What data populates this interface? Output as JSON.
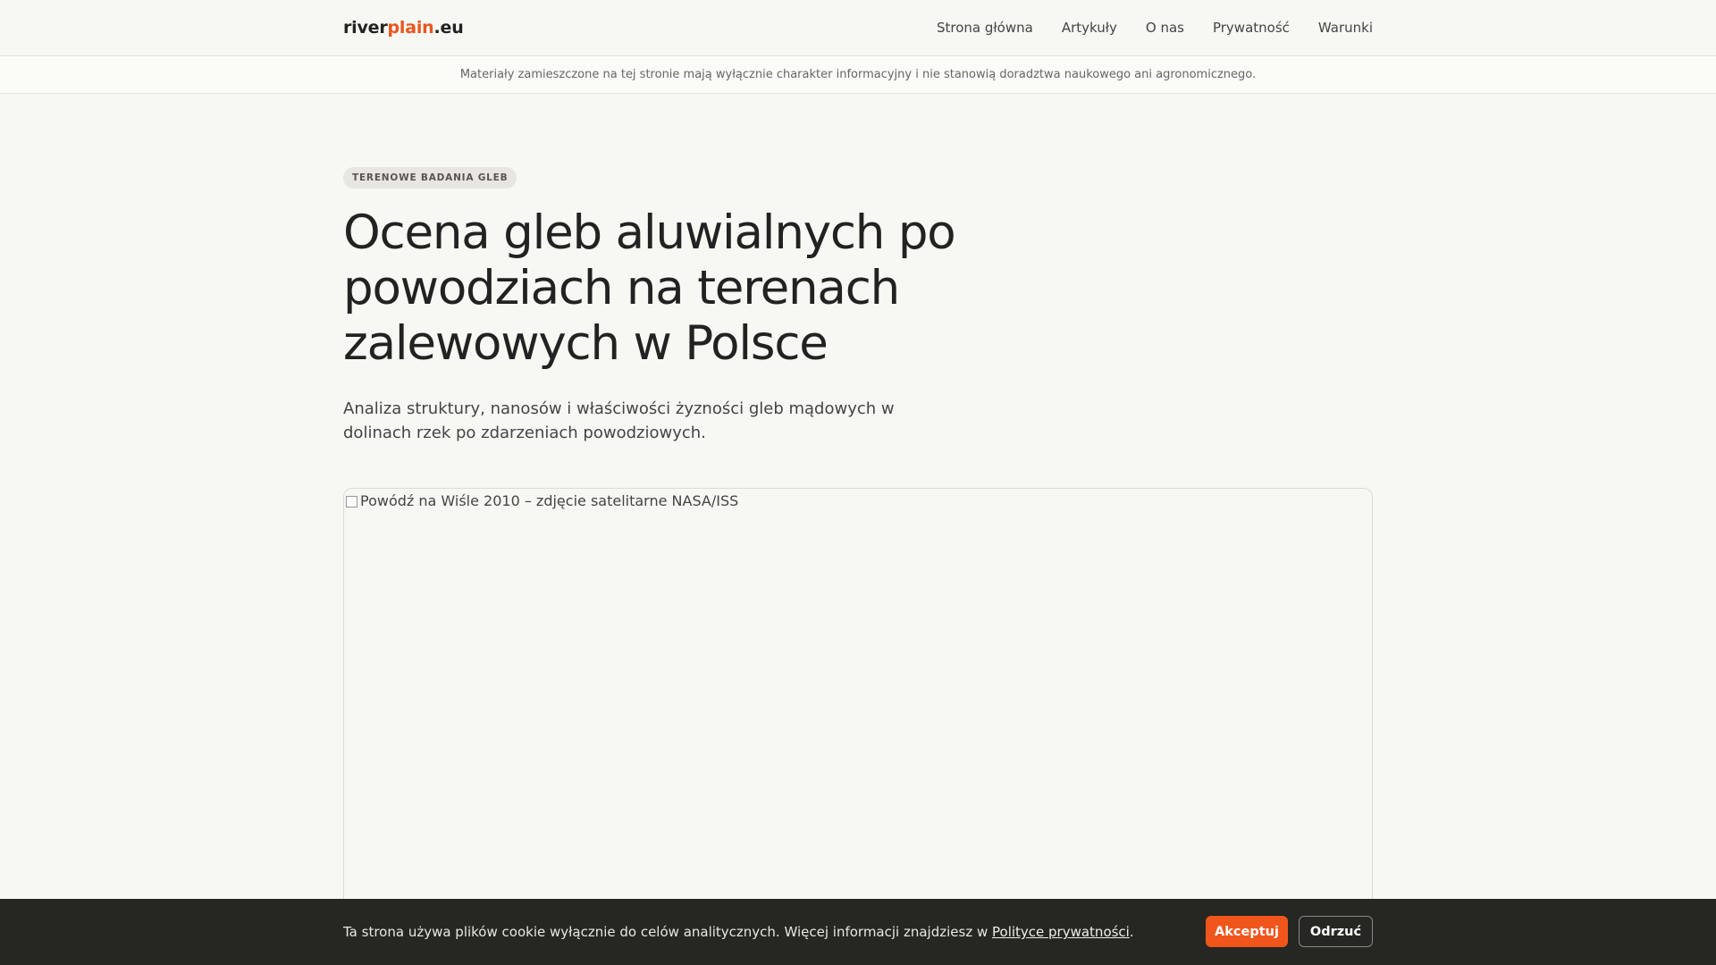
{
  "header": {
    "logo_part1": "river",
    "logo_part2": "plain",
    "logo_part3": ".eu",
    "nav": [
      {
        "label": "Strona główna"
      },
      {
        "label": "Artykuły"
      },
      {
        "label": "O nas"
      },
      {
        "label": "Prywatność"
      },
      {
        "label": "Warunki"
      }
    ]
  },
  "disclaimer": {
    "text": "Materiały zamieszczone na tej stronie mają wyłącznie charakter informacyjny i nie stanowią doradztwa naukowego ani agronomicznego."
  },
  "article": {
    "tag": "TERENOWE BADANIA GLEB",
    "title": "Ocena gleb aluwialnych po powodziach na terenach zalewowych w Polsce",
    "subtitle": "Analiza struktury, nanosów i właściwości żyzności gleb mądowych w dolinach rzek po zdarzeniach powodziowych.",
    "image_alt": "Powódź na Wiśle 2010 – zdjęcie satelitarne NASA/ISS"
  },
  "cookie": {
    "text_before": "Ta strona używa plików cookie wyłącznie do celów analitycznych. Więcej informacji znajdziesz w ",
    "link_text": "Polityce prywatności",
    "text_after": ".",
    "accept_label": "Akceptuj",
    "reject_label": "Odrzuć"
  },
  "colors": {
    "accent": "#e8561f",
    "background": "#f7f7f3",
    "cookie_bg": "#262622"
  }
}
